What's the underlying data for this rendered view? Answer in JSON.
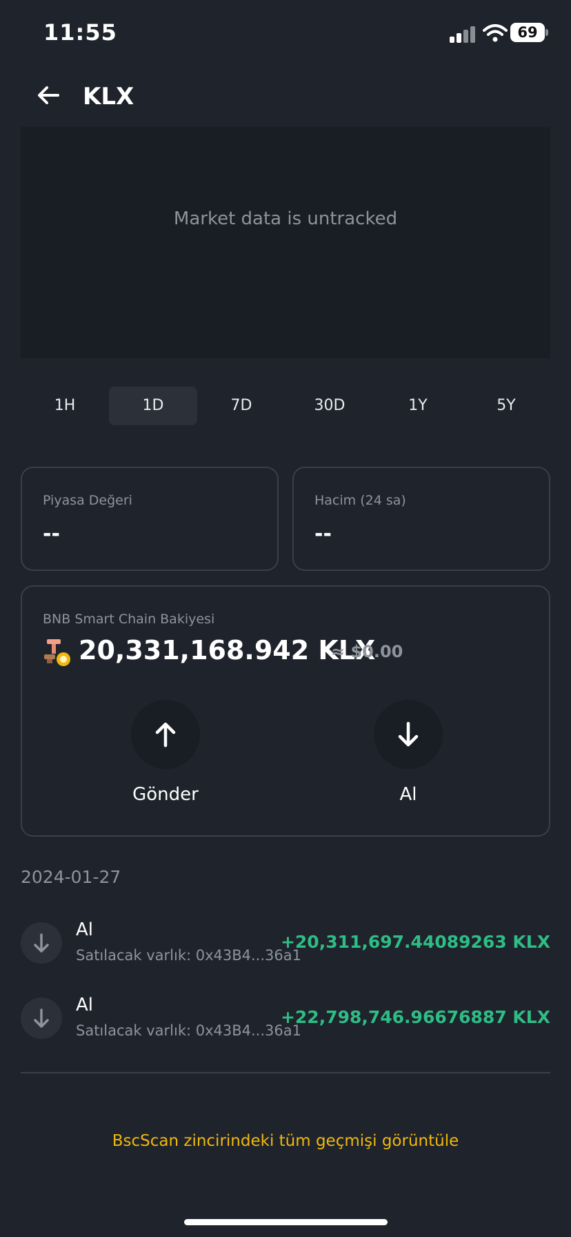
{
  "status_bar": {
    "time": "11:55",
    "battery": "69"
  },
  "header": {
    "title": "KLX"
  },
  "chart": {
    "message": "Market data is untracked"
  },
  "timeframes": [
    {
      "label": "1H",
      "active": false
    },
    {
      "label": "1D",
      "active": true
    },
    {
      "label": "7D",
      "active": false
    },
    {
      "label": "30D",
      "active": false
    },
    {
      "label": "1Y",
      "active": false
    },
    {
      "label": "5Y",
      "active": false
    }
  ],
  "stats": {
    "market_cap": {
      "label": "Piyasa Değeri",
      "value": "--"
    },
    "volume": {
      "label": "Hacim (24 sa)",
      "value": "--"
    }
  },
  "balance": {
    "label": "BNB Smart Chain Bakiyesi",
    "amount": "20,331,168.942 KLX",
    "usd": "≈ $0.00",
    "send_label": "Gönder",
    "receive_label": "Al"
  },
  "history": {
    "date": "2024-01-27",
    "transactions": [
      {
        "title": "Al",
        "subtitle": "Satılacak varlık: 0x43B4...36a1",
        "amount": "+20,311,697.44089263 KLX"
      },
      {
        "title": "Al",
        "subtitle": "Satılacak varlık: 0x43B4...36a1",
        "amount": "+22,798,746.96676887 KLX"
      }
    ]
  },
  "footer": {
    "view_all": "BscScan zincirindeki tüm geçmişi görüntüle"
  },
  "colors": {
    "background": "#1f232c",
    "chart_bg": "#191d24",
    "positive": "#2ebd85",
    "accent": "#f0b90b",
    "muted": "#8f949c"
  },
  "icons": [
    "back-arrow-icon",
    "signal-icon",
    "wifi-icon",
    "battery-icon",
    "send-arrow-up-icon",
    "receive-arrow-down-icon",
    "token-logo-icon"
  ]
}
